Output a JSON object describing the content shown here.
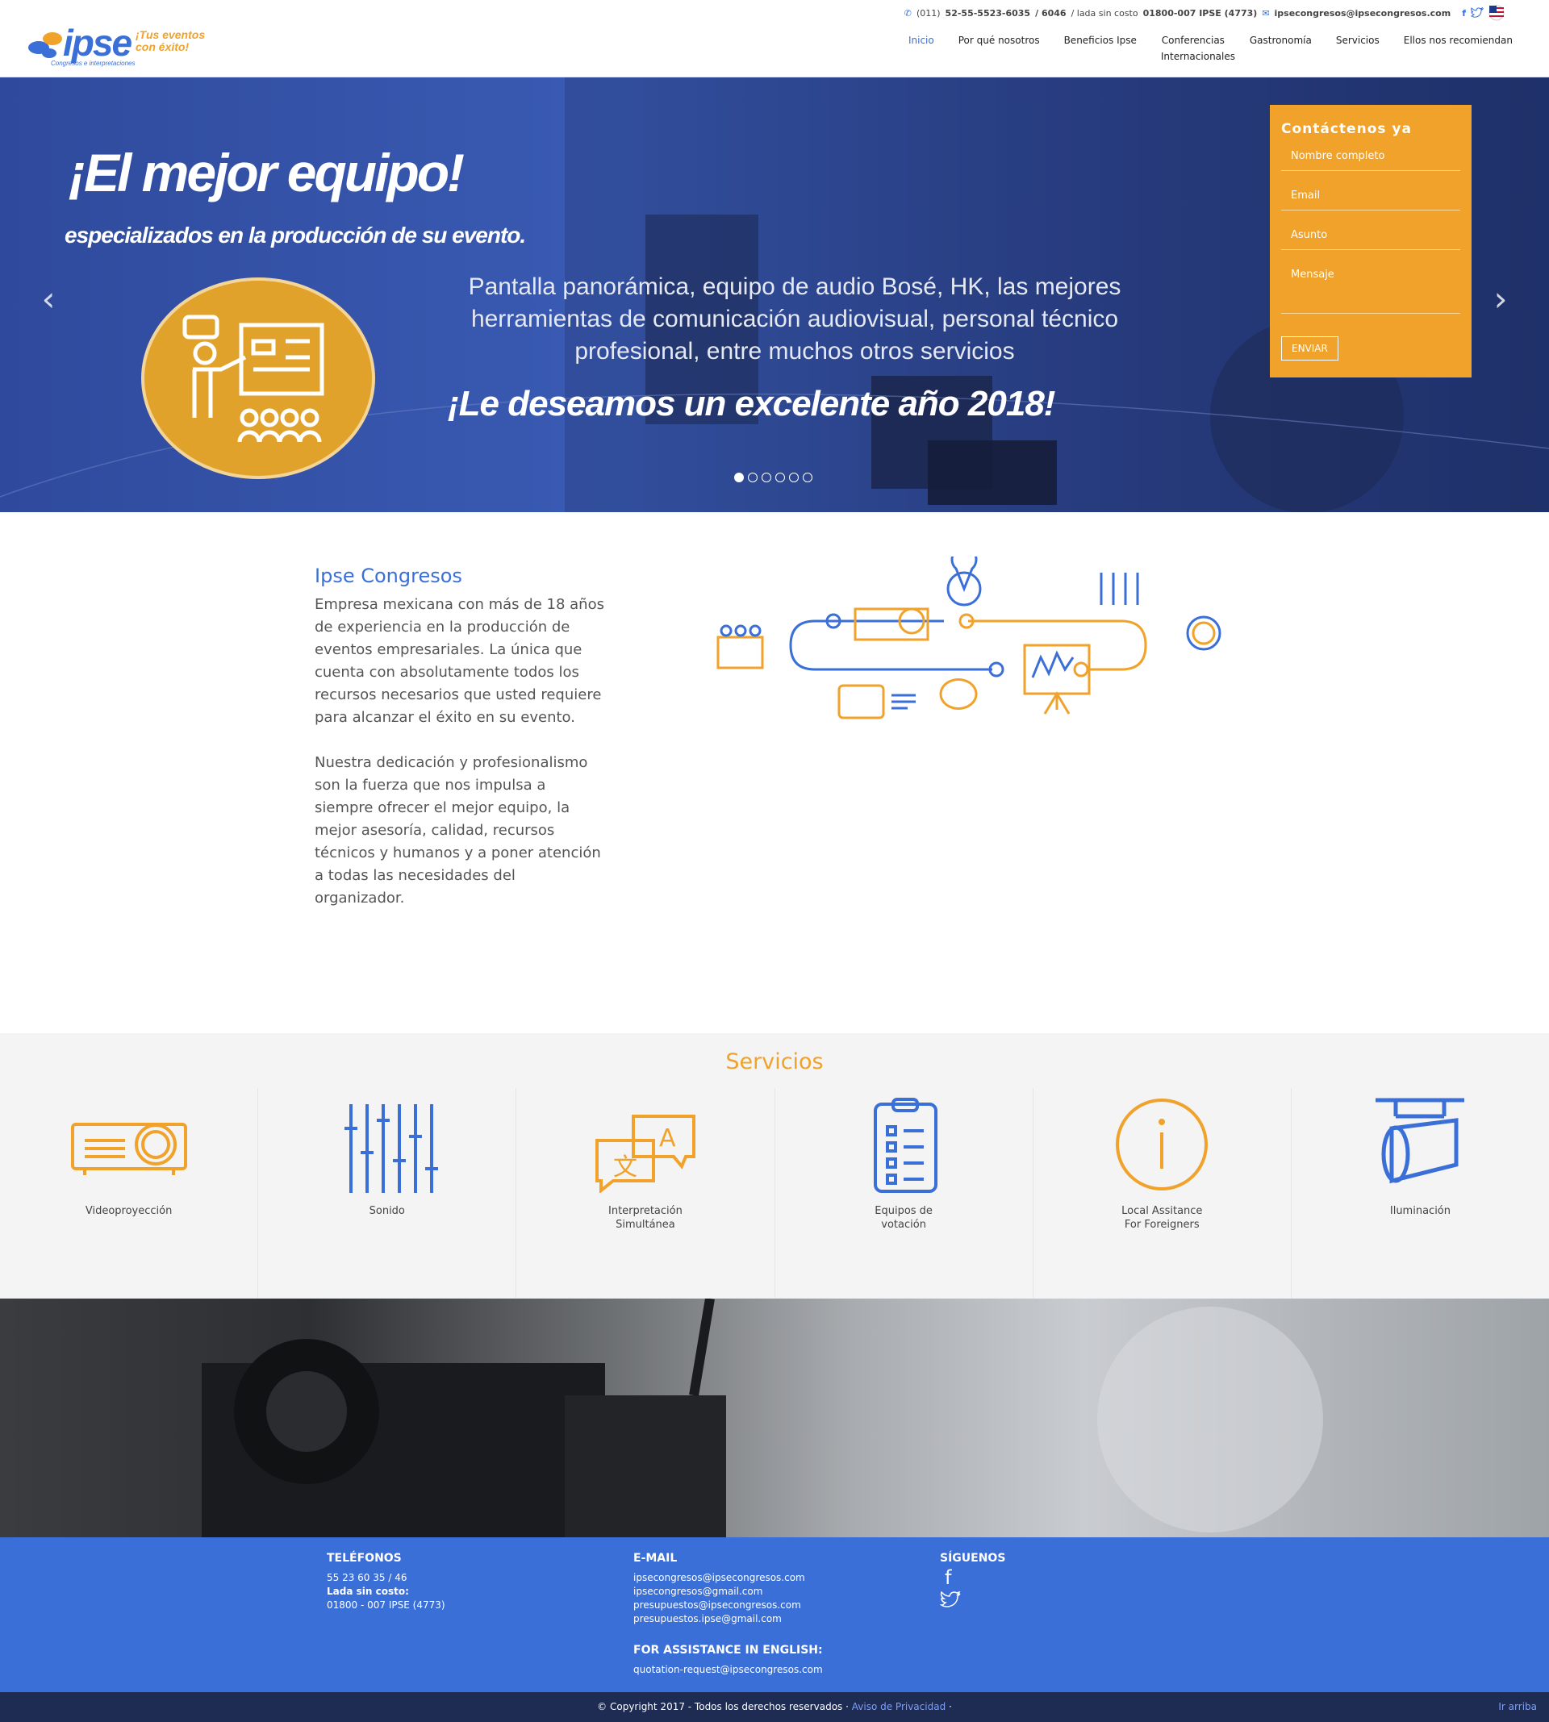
{
  "header": {
    "logo_word": "ipse",
    "logo_tagline": "¡Tus eventos con éxito!",
    "logo_sub": "Congresos e interpretaciones",
    "phone_prefix": "(011)",
    "phone": "52-55-5523-6035",
    "phone_ext": "/ 6046",
    "toll_label": "/ lada sin costo",
    "toll": "01800-007 IPSE (4773)",
    "email": "ipsecongresos@ipsecongresos.com",
    "nav": [
      "Inicio",
      "Por qué nosotros",
      "Beneficios Ipse",
      "Conferencias Internacionales",
      "Gastronomía",
      "Servicios",
      "Ellos nos recomiendan"
    ],
    "active_nav": "Inicio"
  },
  "hero": {
    "title": "¡El mejor equipo!",
    "subtitle": "especializados en la producción de su evento.",
    "body": "Pantalla panorámica, equipo de audio Bosé, HK, las mejores herramientas de comunicación audiovisual, personal técnico profesional, entre muchos otros servicios",
    "greeting": "¡Le deseamos un excelente año 2018!",
    "slides": 6,
    "active_slide": 1
  },
  "contact_form": {
    "title": "Contáctenos ya",
    "name_placeholder": "Nombre completo",
    "email_placeholder": "Email",
    "subject_placeholder": "Asunto",
    "message_placeholder": "Mensaje",
    "submit": "ENVIAR"
  },
  "about": {
    "title": "Ipse Congresos",
    "p1": "Empresa mexicana con más de 18 años de experiencia en la producción de eventos empresariales. La única que cuenta con absolutamente todos los recursos necesarios que usted requiere para alcanzar el éxito en su evento.",
    "p2": "Nuestra dedicación y profesionalismo son la fuerza que nos impulsa a siempre ofrecer el mejor equipo, la mejor asesoría, calidad, recursos técnicos y humanos y a poner atención a todas las necesidades del organizador."
  },
  "services": {
    "title": "Servicios",
    "items": [
      {
        "label": "Videoproyección",
        "icon": "projector-icon"
      },
      {
        "label": "Sonido",
        "icon": "mixer-icon"
      },
      {
        "label": "Interpretación\nSimultánea",
        "icon": "translation-icon"
      },
      {
        "label": "Equipos de\nvotación",
        "icon": "clipboard-icon"
      },
      {
        "label": "Local Assitance\nFor Foreigners",
        "icon": "info-icon"
      },
      {
        "label": "Iluminación",
        "icon": "spotlight-icon"
      }
    ]
  },
  "footer": {
    "phones_title": "TELÉFONOS",
    "phones": "55 23 60 35 / 46",
    "toll_label": "Lada sin costo:",
    "toll": "01800 - 007 IPSE (4773)",
    "email_title": "E-MAIL",
    "emails": [
      "ipsecongresos@ipsecongresos.com",
      "ipsecongresos@gmail.com",
      "presupuestos@ipsecongresos.com",
      "presupuestos.ipse@gmail.com"
    ],
    "english_title": "FOR ASSISTANCE IN ENGLISH:",
    "english_email": "quotation-request@ipsecongresos.com",
    "follow_title": "SÍGUENOS",
    "copyright": "© Copyright 2017 - Todos los derechos reservados ·",
    "privacy": "Aviso de Privacidad",
    "back_to_top": "Ir arriba"
  },
  "colors": {
    "blue": "#3a6fd8",
    "orange": "#f0a22a"
  }
}
